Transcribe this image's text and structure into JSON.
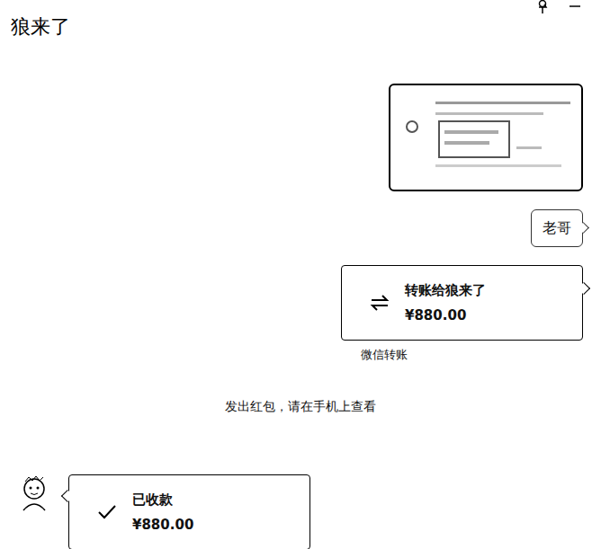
{
  "window": {
    "title": "狼来了"
  },
  "messages": [
    {
      "kind": "image",
      "side": "right"
    },
    {
      "kind": "text",
      "side": "right",
      "text": "老哥"
    },
    {
      "kind": "transfer",
      "side": "right",
      "title": "转账给狼来了",
      "amount": "¥880.00",
      "footer": "微信转账",
      "received": false
    },
    {
      "kind": "system",
      "text": "发出红包，请在手机上查看"
    },
    {
      "kind": "transfer",
      "side": "left",
      "title": "已收款",
      "amount": "¥880.00",
      "received": true
    }
  ]
}
